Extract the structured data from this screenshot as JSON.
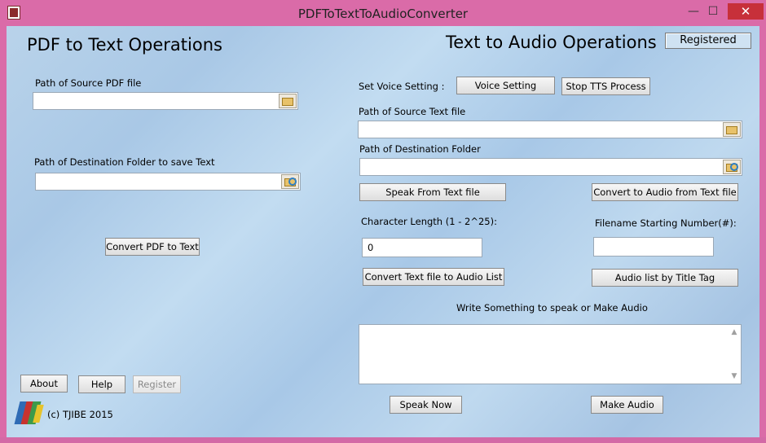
{
  "window": {
    "title": "PDFToTextToAudioConverter",
    "controls": {
      "minimize": "—",
      "maximize": "☐",
      "close": "✕"
    }
  },
  "left": {
    "heading": "PDF to Text Operations",
    "source_label": "Path of Source PDF file",
    "source_value": "",
    "dest_label": "Path of Destination Folder to save Text",
    "dest_value": "",
    "convert_button": "Convert PDF to Text",
    "about_button": "About",
    "help_button": "Help",
    "register_button": "Register",
    "copyright": "(c) TJIBE 2015"
  },
  "right": {
    "heading": "Text to Audio Operations",
    "registered": "Registered",
    "voice_label": "Set Voice Setting :",
    "voice_button": "Voice Setting",
    "stop_button": "Stop TTS Process",
    "source_label": "Path of Source Text file",
    "source_value": "",
    "dest_label": "Path of Destination Folder",
    "dest_value": "",
    "speak_file_button": "Speak From Text file",
    "convert_audio_button": "Convert to Audio from Text file",
    "char_length_label": "Character Length (1 - 2^25):",
    "char_length_value": "0",
    "filename_start_label": "Filename Starting Number(#):",
    "filename_start_value": "",
    "convert_list_button": "Convert Text file to Audio List",
    "title_tag_button": "Audio list by Title Tag",
    "write_label": "Write Something to speak or Make Audio",
    "text_value": "",
    "speak_now_button": "Speak Now",
    "make_audio_button": "Make Audio"
  },
  "icons": {
    "app": "app-book-icon",
    "browse": "folder-browse-icon",
    "logo": "tjibe-logo-icon"
  },
  "colors": {
    "window_frame": "#da6ba8",
    "client_bg": "#b9d3ea",
    "close_button": "#c7303a"
  }
}
